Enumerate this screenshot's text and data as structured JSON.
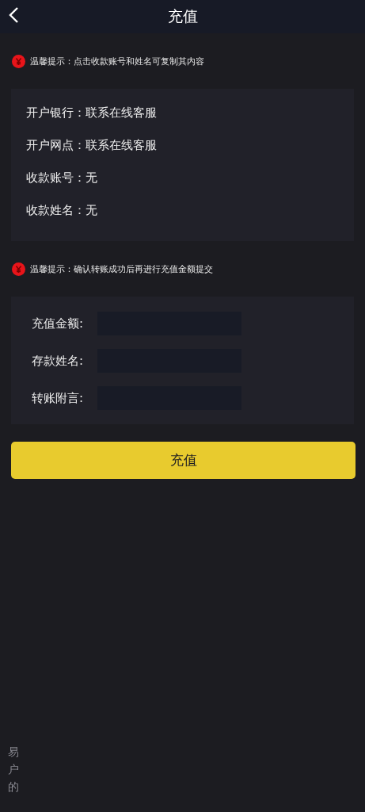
{
  "header": {
    "title": "充值"
  },
  "notice_1": {
    "label": "温馨提示：",
    "text": "点击收款账号和姓名可复制其内容"
  },
  "account_info": [
    {
      "label": "开户银行：",
      "value": "联系在线客服"
    },
    {
      "label": "开户网点：",
      "value": "联系在线客服"
    },
    {
      "label": "收款账号：",
      "value": "无"
    },
    {
      "label": "收款姓名：",
      "value": "无"
    }
  ],
  "notice_2": {
    "label": "温馨提示：",
    "text": "确认转账成功后再进行充值金额提交"
  },
  "form_fields": [
    {
      "label": "充值金额:"
    },
    {
      "label": "存款姓名:"
    },
    {
      "label": "转账附言:"
    }
  ],
  "submit_button": "充值",
  "background_text": [
    "易",
    "户",
    "的"
  ]
}
